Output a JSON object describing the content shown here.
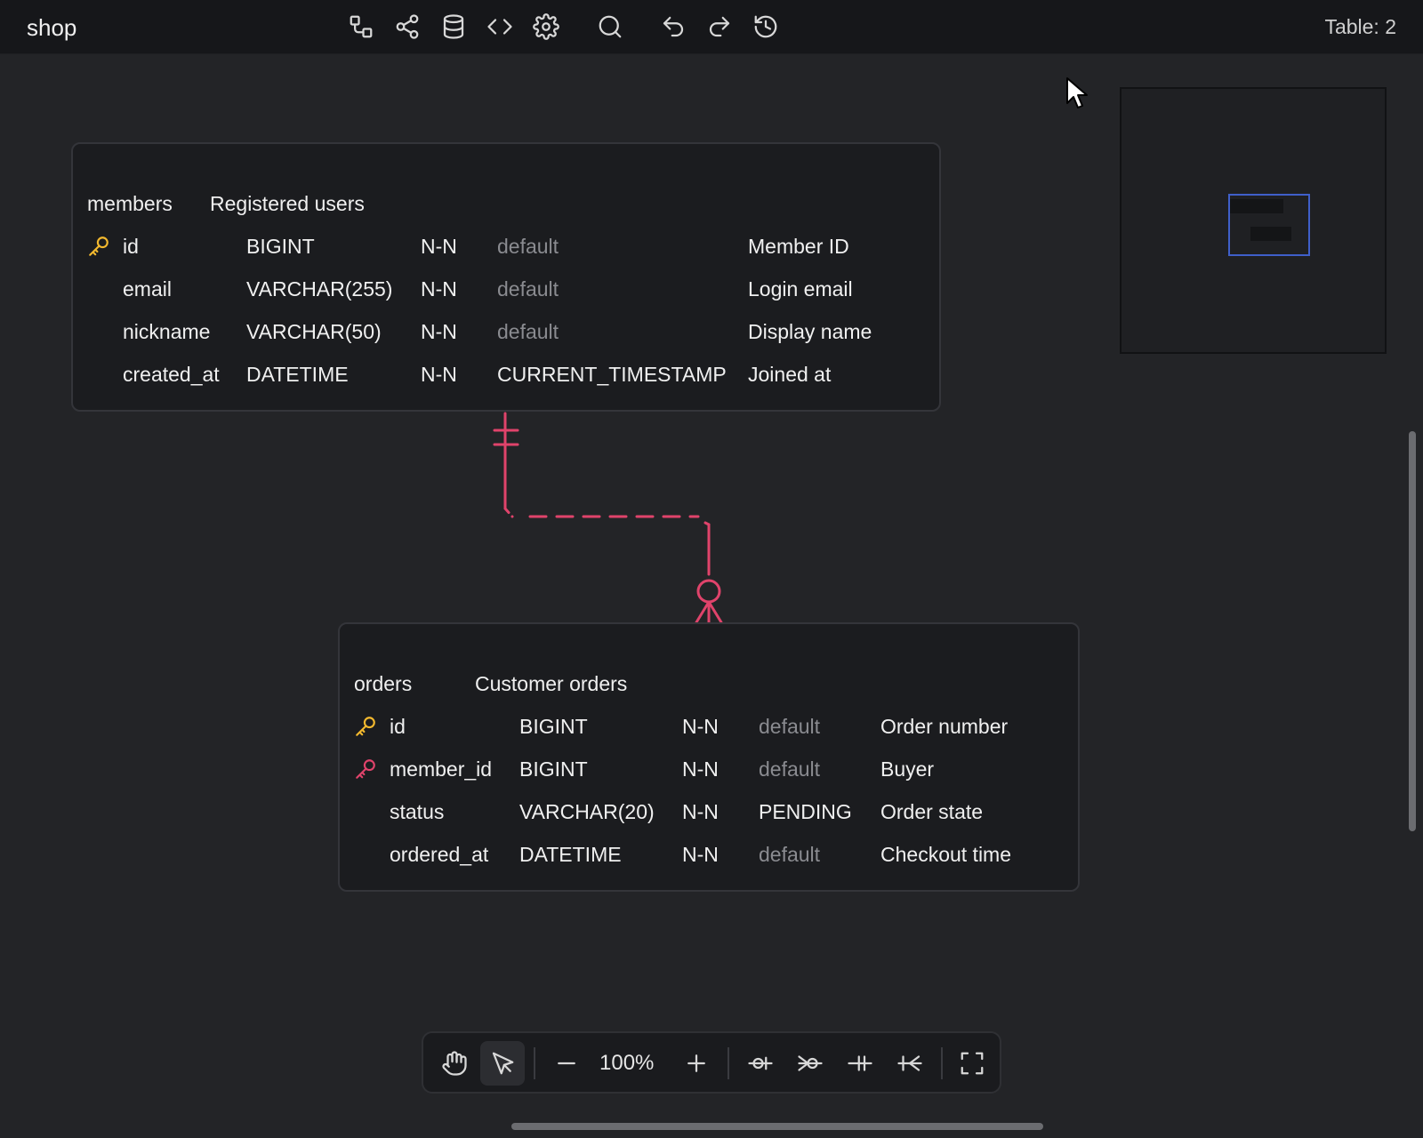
{
  "app": {
    "project_name": "shop",
    "table_count": "Table: 2"
  },
  "toolbar_icons": [
    "relation-icon",
    "share-icon",
    "database-icon",
    "code-icon",
    "gear-icon",
    "search-icon",
    "undo-icon",
    "redo-icon",
    "history-icon"
  ],
  "tables": [
    {
      "name": "members",
      "comment": "Registered users",
      "columns": [
        {
          "key": "primary",
          "name": "id",
          "type": "BIGINT",
          "nullable": "N-N",
          "default": "default",
          "default_set": false,
          "comment": "Member ID"
        },
        {
          "key": "",
          "name": "email",
          "type": "VARCHAR(255)",
          "nullable": "N-N",
          "default": "default",
          "default_set": false,
          "comment": "Login email"
        },
        {
          "key": "",
          "name": "nickname",
          "type": "VARCHAR(50)",
          "nullable": "N-N",
          "default": "default",
          "default_set": false,
          "comment": "Display name"
        },
        {
          "key": "",
          "name": "created_at",
          "type": "DATETIME",
          "nullable": "N-N",
          "default": "CURRENT_TIMESTAMP",
          "default_set": true,
          "comment": "Joined at"
        }
      ]
    },
    {
      "name": "orders",
      "comment": "Customer orders",
      "columns": [
        {
          "key": "primary",
          "name": "id",
          "type": "BIGINT",
          "nullable": "N-N",
          "default": "default",
          "default_set": false,
          "comment": "Order number"
        },
        {
          "key": "foreign",
          "name": "member_id",
          "type": "BIGINT",
          "nullable": "N-N",
          "default": "default",
          "default_set": false,
          "comment": "Buyer"
        },
        {
          "key": "",
          "name": "status",
          "type": "VARCHAR(20)",
          "nullable": "N-N",
          "default": "PENDING",
          "default_set": true,
          "comment": "Order state"
        },
        {
          "key": "",
          "name": "ordered_at",
          "type": "DATETIME",
          "nullable": "N-N",
          "default": "default",
          "default_set": false,
          "comment": "Checkout time"
        }
      ]
    }
  ],
  "relation": {
    "from": "members",
    "to": "orders",
    "from_cardinality": "exactly-one",
    "to_cardinality": "zero-or-many",
    "line_style": "dashed",
    "color": "#e0436b"
  },
  "bottom_toolbar": {
    "zoom_level": "100%",
    "tools": [
      "hand-icon",
      "pointer-icon",
      "zoom-out-icon",
      "zoom-in-icon",
      "zero-one-icon",
      "zero-many-icon",
      "one-one-icon",
      "one-many-icon",
      "fullscreen-icon"
    ],
    "active_tool": "pointer-icon"
  },
  "colors": {
    "background": "#232427",
    "table": "#1b1c1f",
    "primary_key": "#f2b82e",
    "foreign_key": "#e0436b",
    "minimap_viewport": "#3f5fc9"
  }
}
